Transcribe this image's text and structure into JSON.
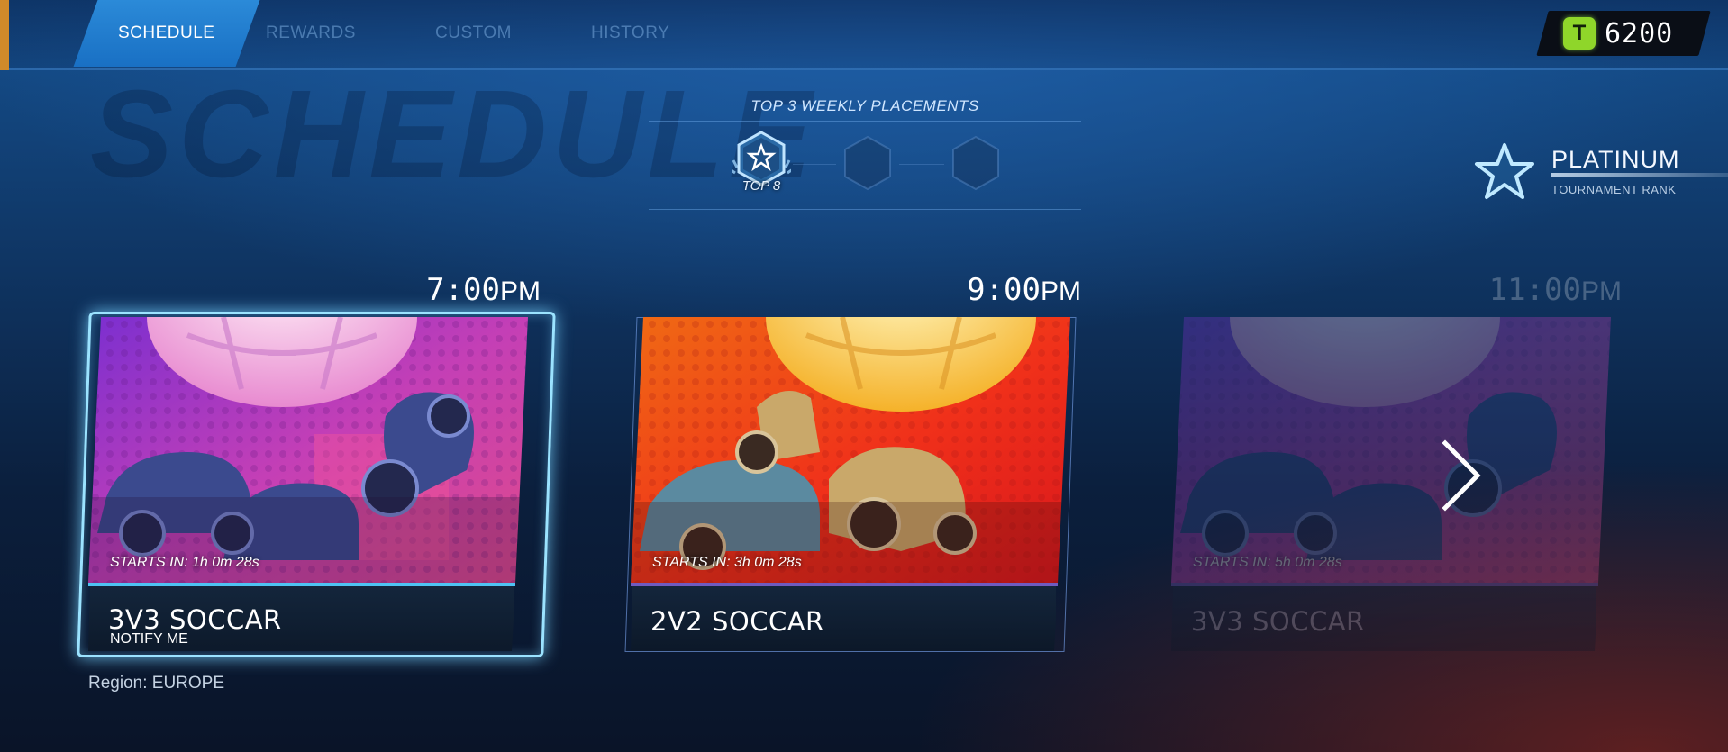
{
  "tabs": [
    {
      "label": "SCHEDULE",
      "active": true
    },
    {
      "label": "REWARDS",
      "active": false
    },
    {
      "label": "CUSTOM",
      "active": false
    },
    {
      "label": "HISTORY",
      "active": false
    }
  ],
  "currency": {
    "icon": "credits-icon",
    "value": "6200",
    "color": "#8fd62a"
  },
  "watermark": "SCHEDULE",
  "weekly": {
    "title": "TOP 3 WEEKLY PLACEMENTS",
    "placements": [
      {
        "label": "TOP 8",
        "earned": true
      },
      {
        "label": "",
        "earned": false
      },
      {
        "label": "",
        "earned": false
      }
    ]
  },
  "rank": {
    "name": "PLATINUM",
    "subtitle": "TOURNAMENT RANK",
    "icon": "star-icon"
  },
  "cards": [
    {
      "time": "7:00",
      "ampm": "PM",
      "starts_in": "STARTS IN: 1h 0m 28s",
      "mode": "3V3 SOCCAR",
      "action": "NOTIFY ME",
      "selected": true,
      "accent": "#4ec3f3"
    },
    {
      "time": "9:00",
      "ampm": "PM",
      "starts_in": "STARTS IN: 3h 0m 28s",
      "mode": "2V2 SOCCAR",
      "action": "",
      "selected": false,
      "accent": "#6f5bc0"
    },
    {
      "time": "11:00",
      "ampm": "PM",
      "starts_in": "STARTS IN: 5h 0m 28s",
      "mode": "3V3 SOCCAR",
      "action": "",
      "selected": false,
      "accent": "#6f5bc0"
    }
  ],
  "region": "Region: EUROPE"
}
